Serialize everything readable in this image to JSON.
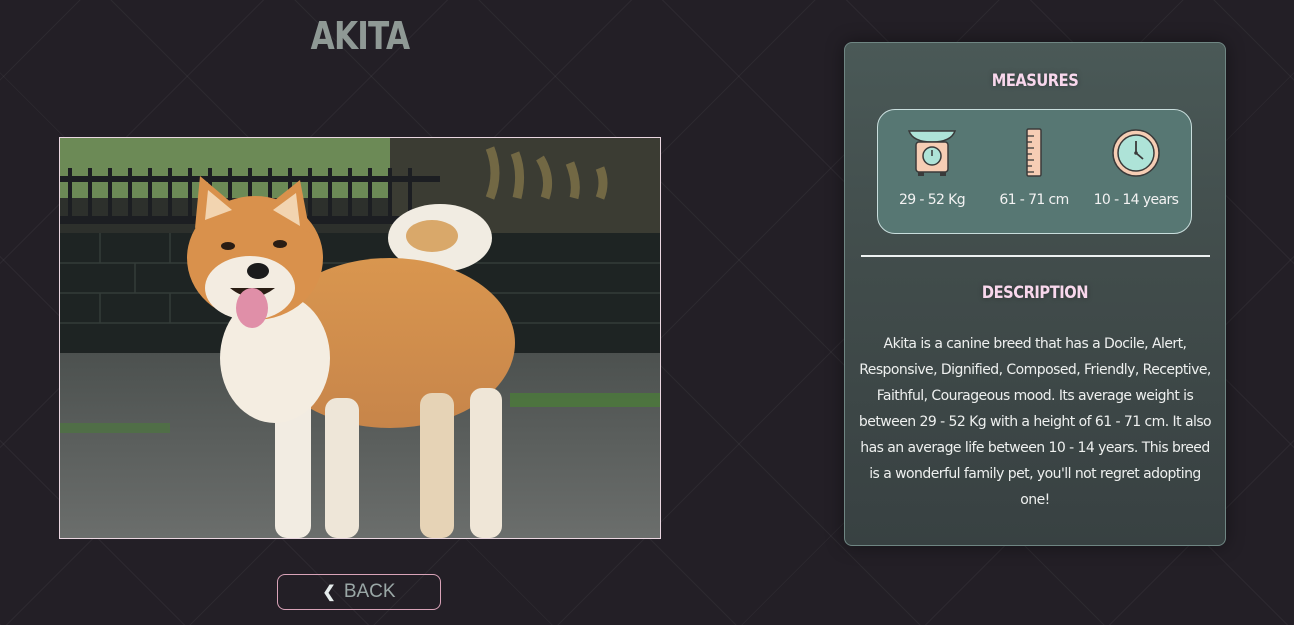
{
  "breed": {
    "name": "AKITA"
  },
  "photo": {
    "alt": "Akita"
  },
  "navigation": {
    "back_label": "BACK"
  },
  "measures": {
    "heading": "MEASURES",
    "items": [
      {
        "icon": "scale-icon",
        "value": "29 - 52 Kg"
      },
      {
        "icon": "ruler-icon",
        "value": "61 - 71 cm"
      },
      {
        "icon": "clock-icon",
        "value": "10 - 14 years"
      }
    ]
  },
  "description": {
    "heading": "DESCRIPTION",
    "text": "Akita is a canine breed that has a Docile, Alert, Responsive, Dignified, Composed, Friendly, Receptive, Faithful, Courageous mood. Its average weight is between 29 - 52 Kg with a height of 61 - 71 cm. It also has an average life between 10 - 14 years. This breed is a wonderful family pet, you'll not regret adopting one!"
  },
  "colors": {
    "background": "#231f26",
    "title": "#8f9995",
    "card": "#434e4d",
    "measures_box": "#577773",
    "heading_pink": "#f8d7ec",
    "icon_mint": "#aee3d8",
    "icon_peach": "#f6cdb4",
    "button_border": "#d9a3b8"
  }
}
